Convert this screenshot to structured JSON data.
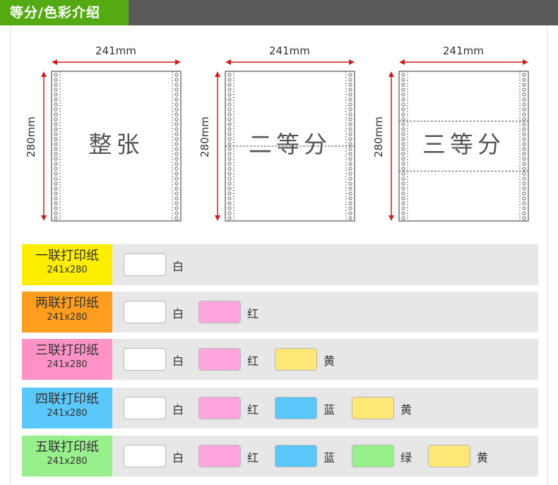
{
  "header": {
    "title": "等分/色彩介绍"
  },
  "diagrams": [
    {
      "width_label": "241mm",
      "height_label": "280mm",
      "label": "整张",
      "divisions": 1
    },
    {
      "width_label": "241mm",
      "height_label": "280mm",
      "label": "二等分",
      "divisions": 2
    },
    {
      "width_label": "241mm",
      "height_label": "280mm",
      "label": "三等分",
      "divisions": 3
    }
  ],
  "rows": [
    {
      "name": "一联打印纸",
      "size": "241x280",
      "tag_color": "#ffee00",
      "colors": [
        {
          "label": "白",
          "fill": "#ffffff"
        }
      ]
    },
    {
      "name": "两联打印纸",
      "size": "241x280",
      "tag_color": "#ff9d1e",
      "colors": [
        {
          "label": "白",
          "fill": "#ffffff"
        },
        {
          "label": "红",
          "fill": "#ffa6de"
        }
      ]
    },
    {
      "name": "三联打印纸",
      "size": "241x280",
      "tag_color": "#ff93c8",
      "colors": [
        {
          "label": "白",
          "fill": "#ffffff"
        },
        {
          "label": "红",
          "fill": "#ffa6de"
        },
        {
          "label": "黄",
          "fill": "#ffe877"
        }
      ]
    },
    {
      "name": "四联打印纸",
      "size": "241x280",
      "tag_color": "#5ac8fa",
      "colors": [
        {
          "label": "白",
          "fill": "#ffffff"
        },
        {
          "label": "红",
          "fill": "#ffa6de"
        },
        {
          "label": "蓝",
          "fill": "#5ac8fa"
        },
        {
          "label": "黄",
          "fill": "#ffe877"
        }
      ]
    },
    {
      "name": "五联打印纸",
      "size": "241x280",
      "tag_color": "#98f08c",
      "colors": [
        {
          "label": "白",
          "fill": "#ffffff"
        },
        {
          "label": "红",
          "fill": "#ffa6de"
        },
        {
          "label": "蓝",
          "fill": "#5ac8fa"
        },
        {
          "label": "绿",
          "fill": "#98f08c"
        },
        {
          "label": "黄",
          "fill": "#ffe877"
        }
      ]
    }
  ]
}
